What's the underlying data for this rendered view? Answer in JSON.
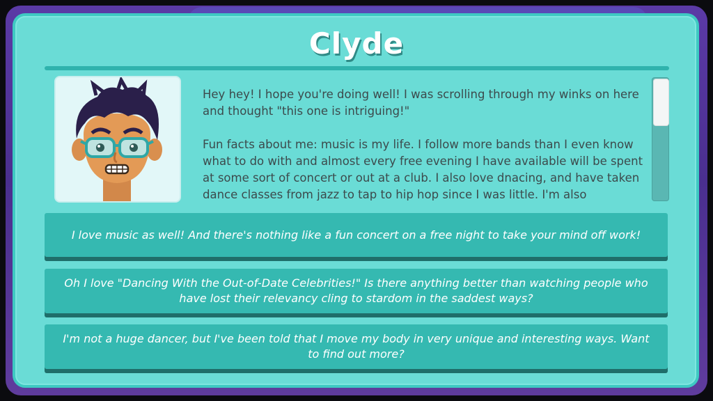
{
  "character": {
    "name": "Clyde",
    "portrait_icon": "clyde-portrait-icon",
    "bio": "Hey hey! I hope you're doing well! I was scrolling through my winks on here and thought \"this one is intriguing!\"\n\nFun facts about me: music is my life. I follow more bands than I even know what to do with and almost every free evening I have available will be spent at some sort of concert or out at a club. I also love dnacing, and have taken dance classes from jazz to tap to hip hop since I was little. I'm also"
  },
  "choices": [
    {
      "text": "I love music as well! And there's nothing like a fun concert on a free night to take your mind off work!"
    },
    {
      "text": "Oh I love \"Dancing With the Out-of-Date Celebrities!\" Is there anything better than watching people who have lost their relevancy cling to stardom in the saddest ways?"
    },
    {
      "text": "I'm not a huge dancer, but I've been told that I move my body in very unique and interesting ways. Want to find out more?"
    }
  ],
  "colors": {
    "panel": "#6adcd6",
    "choice": "#35b9b1",
    "choice_shadow": "#1f6e6a",
    "frame": "#5b3aa6"
  }
}
